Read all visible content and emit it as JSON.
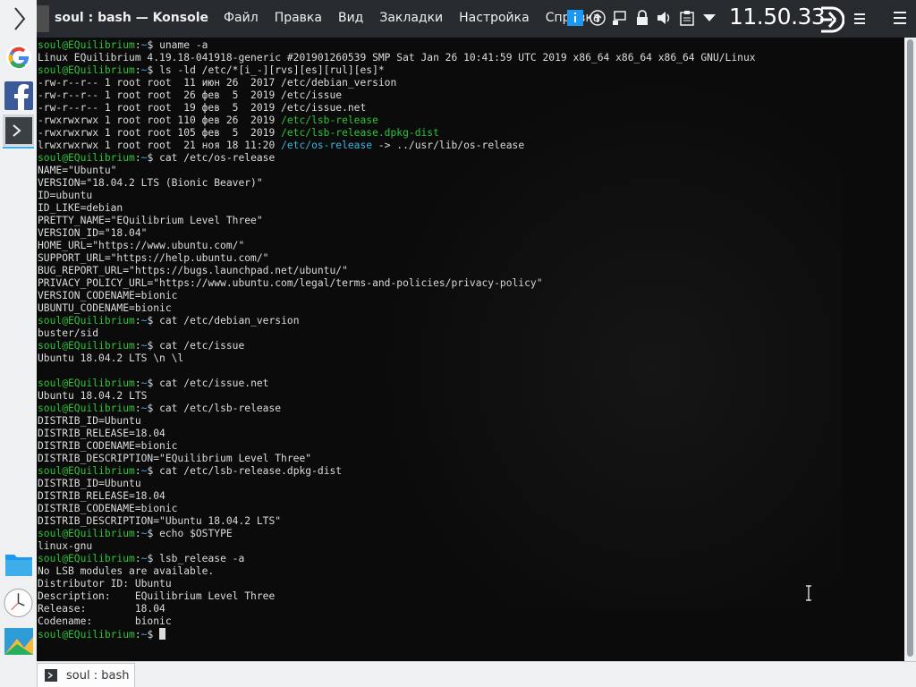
{
  "window": {
    "title": "soul : bash — Konsole"
  },
  "menu": [
    "Файл",
    "Правка",
    "Вид",
    "Закладки",
    "Настройка",
    "Справка"
  ],
  "clock": "11.50.33",
  "tab": {
    "label": "soul : bash"
  },
  "prompt": {
    "user_host": "soul@EQuilibrium",
    "sep": ":",
    "dir": "~",
    "dollar": "$ "
  },
  "terminal": {
    "l0_cmd": "uname -a",
    "l1": "Linux EQuilibrium 4.19.18-041918-generic #201901260539 SMP Sat Jan 26 10:41:59 UTC 2019 x86_64 x86_64 x86_64 GNU/Linux",
    "l2_cmd": "ls -ld /etc/*[i_-][rvs][es][rul][es]*",
    "l3_a": "-rw-r--r-- 1 root root  11 июн 26  2017 /etc/debian_version",
    "l4_a": "-rw-r--r-- 1 root root  26 фев  5  2019 /etc/issue",
    "l5_a": "-rw-r--r-- 1 root root  19 фев  5  2019 /etc/issue.net",
    "l6_a": "-rwxrwxrwx 1 root root 110 фев 26  2019 ",
    "l6_b": "/etc/lsb-release",
    "l7_a": "-rwxrwxrwx 1 root root 105 фев  5  2019 ",
    "l7_b": "/etc/lsb-release.dpkg-dist",
    "l8_a": "lrwxrwxrwx 1 root root  21 ноя 18 11:20 ",
    "l8_b": "/etc/os-release",
    "l8_c": " -> ../usr/lib/os-release",
    "l9_cmd": "cat /etc/os-release",
    "l10": "NAME=\"Ubuntu\"",
    "l11": "VERSION=\"18.04.2 LTS (Bionic Beaver)\"",
    "l12": "ID=ubuntu",
    "l13": "ID_LIKE=debian",
    "l14": "PRETTY_NAME=\"EQuilibrium Level Three\"",
    "l15": "VERSION_ID=\"18.04\"",
    "l16": "HOME_URL=\"https://www.ubuntu.com/\"",
    "l17": "SUPPORT_URL=\"https://help.ubuntu.com/\"",
    "l18": "BUG_REPORT_URL=\"https://bugs.launchpad.net/ubuntu/\"",
    "l19": "PRIVACY_POLICY_URL=\"https://www.ubuntu.com/legal/terms-and-policies/privacy-policy\"",
    "l20": "VERSION_CODENAME=bionic",
    "l21": "UBUNTU_CODENAME=bionic",
    "l22_cmd": "cat /etc/debian_version",
    "l23": "buster/sid",
    "l24_cmd": "cat /etc/issue",
    "l25": "Ubuntu 18.04.2 LTS \\n \\l",
    "l27_cmd": "cat /etc/issue.net",
    "l28": "Ubuntu 18.04.2 LTS",
    "l29_cmd": "cat /etc/lsb-release",
    "l30": "DISTRIB_ID=Ubuntu",
    "l31": "DISTRIB_RELEASE=18.04",
    "l32": "DISTRIB_CODENAME=bionic",
    "l33": "DISTRIB_DESCRIPTION=\"EQuilibrium Level Three\"",
    "l34_cmd": "cat /etc/lsb-release.dpkg-dist",
    "l35": "DISTRIB_ID=Ubuntu",
    "l36": "DISTRIB_RELEASE=18.04",
    "l37": "DISTRIB_CODENAME=bionic",
    "l38": "DISTRIB_DESCRIPTION=\"Ubuntu 18.04.2 LTS\"",
    "l39_cmd": "echo $OSTYPE",
    "l40": "linux-gnu",
    "l41_cmd": "lsb_release -a",
    "l42": "No LSB modules are available.",
    "l43": "Distributor ID: Ubuntu",
    "l44": "Description:    EQuilibrium Level Three",
    "l45": "Release:        18.04",
    "l46": "Codename:       bionic"
  },
  "colors": {
    "prompt": "#2fc23a",
    "path": "#4aa8e8",
    "symlink": "#3ab6e0",
    "titlebar": "#272a2e",
    "terminal_bg": "#0b0b0b"
  }
}
